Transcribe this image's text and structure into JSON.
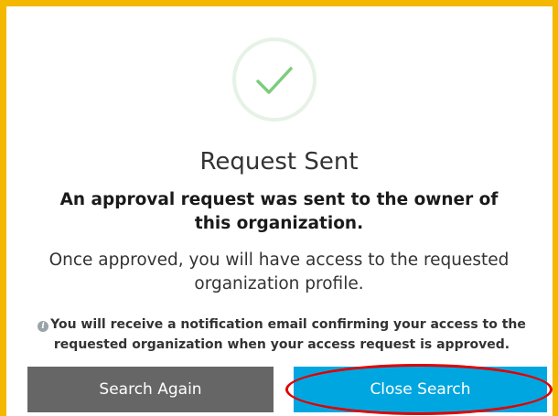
{
  "dialog": {
    "title": "Request Sent",
    "subtitle": "An approval request was sent to the owner of this organization.",
    "body": "Once approved, you will have access to the requested organization profile.",
    "note": "You will receive a notification email confirming your access to the requested organization when your access request is approved.",
    "success_icon": "checkmark-icon",
    "info_icon": "info-icon",
    "info_glyph": "i"
  },
  "buttons": {
    "search_again": "Search Again",
    "close_search": "Close Search"
  },
  "colors": {
    "frame_border": "#f5b800",
    "checkmark": "#7dcc7d",
    "search_again_bg": "#666666",
    "close_search_bg": "#00a6e0",
    "highlight": "#e00000"
  }
}
